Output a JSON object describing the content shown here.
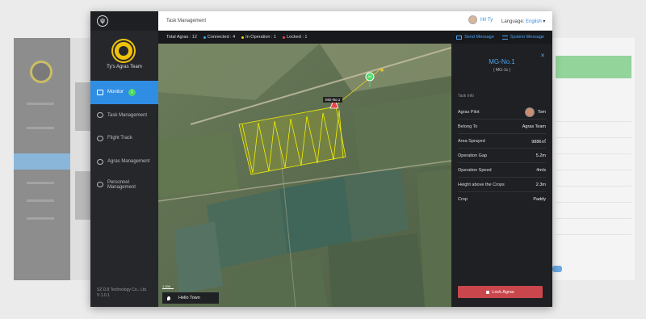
{
  "header": {
    "title": "Task Management",
    "user_greeting": "Hi! Ty",
    "language_label": "Language:",
    "language_value": "English"
  },
  "sidebar": {
    "team_name": "Ty's Agras Team",
    "items": [
      {
        "label": "Monitor",
        "badge": "1",
        "active": true
      },
      {
        "label": "Task Management"
      },
      {
        "label": "Flight Track"
      },
      {
        "label": "Agras Management"
      },
      {
        "label": "Personnel Management"
      }
    ],
    "footer_line1": "SZ DJI Technology Co., Ltd.",
    "footer_line2": "V 1.0.1"
  },
  "status": {
    "total": "Total Agras : 12",
    "connected": "Connected : 4",
    "operation": "In Operation : 1",
    "locked": "Locked : 1",
    "send_message": "Send Message",
    "system_message": "System Message",
    "colors": {
      "connected": "#3fa9f5",
      "operation": "#f5d020",
      "locked": "#e8454a"
    }
  },
  "map": {
    "drone_label": "MG-No.1",
    "location": "Hello Town",
    "scale": "1 000"
  },
  "panel": {
    "name": "MG-No.1",
    "sub": "( MG-1s )",
    "section": "Task Info",
    "rows": [
      {
        "k": "Agras Pilot",
        "v": "Tom"
      },
      {
        "k": "Belong To",
        "v": "Agras Team"
      },
      {
        "k": "Area Sprayed",
        "v": "9886㎡"
      },
      {
        "k": "Operation Gap",
        "v": "5.2m"
      },
      {
        "k": "Operation Speed",
        "v": "4m/s"
      },
      {
        "k": "Height above the Crops",
        "v": "2.3m"
      },
      {
        "k": "Crop",
        "v": "Paddy"
      }
    ],
    "lock_button": "Lock Agras",
    "close": "✕"
  },
  "app_icon": "dji-logo-icon"
}
